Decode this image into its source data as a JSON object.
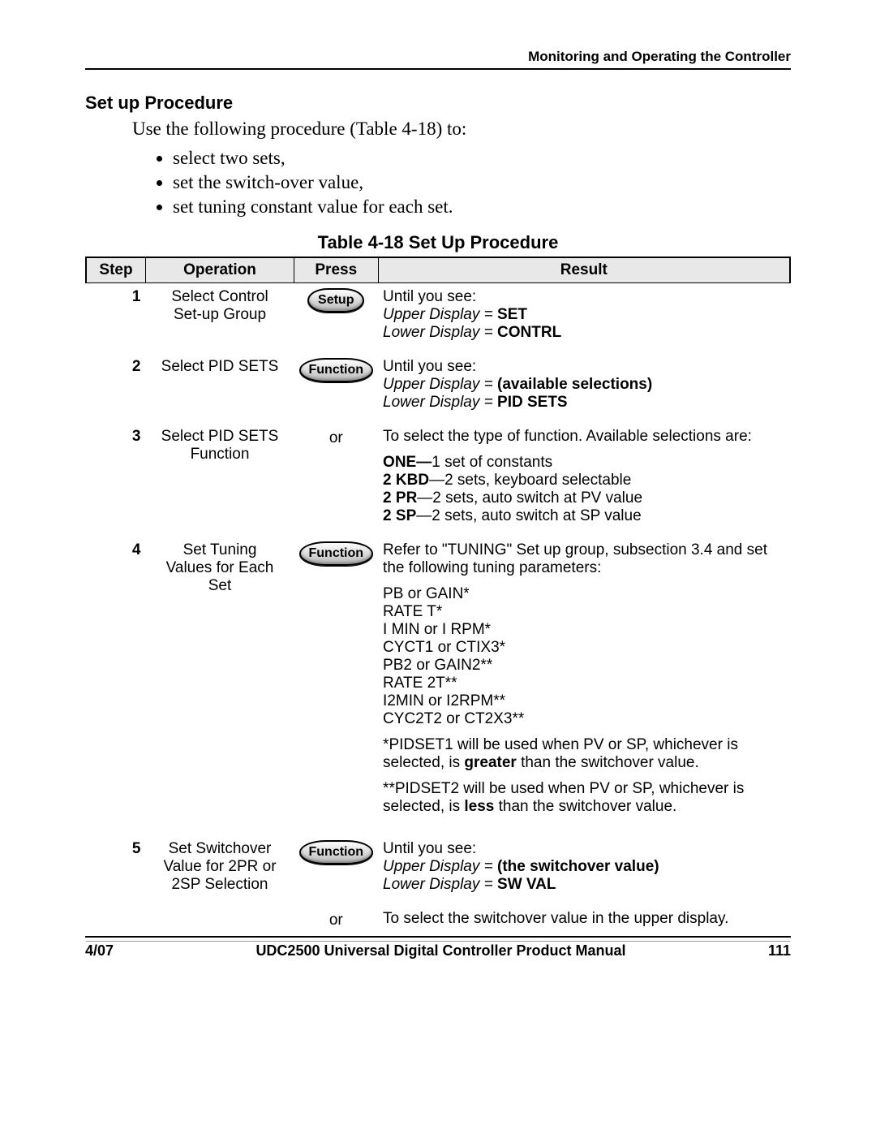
{
  "header": {
    "right": "Monitoring and Operating the Controller"
  },
  "section_title": "Set up Procedure",
  "intro": "Use the following procedure (Table 4-18) to:",
  "bullets": [
    "select two sets,",
    "set the switch-over value,",
    "set tuning constant value for each set."
  ],
  "table_caption": "Table 4-18  Set Up Procedure",
  "thead": {
    "step": "Step",
    "operation": "Operation",
    "press": "Press",
    "result": "Result"
  },
  "keys": {
    "setup": "Setup",
    "function": "Function",
    "or": "or"
  },
  "rows": {
    "r1": {
      "step": "1",
      "op1": "Select Control",
      "op2": "Set-up Group",
      "res_until": "Until you see:",
      "res_upper_lbl": "Upper Display = ",
      "res_upper_val": "SET",
      "res_lower_lbl": "Lower Display = ",
      "res_lower_val": "CONTRL"
    },
    "r2": {
      "step": "2",
      "op1": "Select PID SETS",
      "res_until": "Until you see:",
      "res_upper_lbl": "Upper Display = ",
      "res_upper_val": "(available selections)",
      "res_lower_lbl": "Lower Display = ",
      "res_lower_val": "PID SETS"
    },
    "r3": {
      "step": "3",
      "op1": "Select PID SETS",
      "op2": "Function",
      "res_intro": "To select the type of function. Available selections are:",
      "one_b": "ONE—",
      "one_t": "1 set of constants",
      "kbd_b": "2 KBD",
      "kbd_t": "—2 sets, keyboard selectable",
      "pr_b": "2 PR",
      "pr_t": "—2 sets, auto switch at PV value",
      "sp_b": "2 SP",
      "sp_t": "—2 sets, auto switch at SP value"
    },
    "r4": {
      "step": "4",
      "op1": "Set Tuning",
      "op2": "Values for Each",
      "op3": "Set",
      "res_intro": "Refer to \"TUNING\" Set up group, subsection 3.4 and set the following tuning parameters:",
      "p1": "PB or GAIN*",
      "p2": "RATE T*",
      "p3": "I MIN or I RPM*",
      "p4": "CYCT1 or CTIX3*",
      "p5": "PB2 or GAIN2**",
      "p6": "RATE 2T**",
      "p7": "I2MIN or I2RPM**",
      "p8": "CYC2T2 or CT2X3**",
      "note1a": "*PIDSET1 will be used when PV or SP, whichever is selected, is ",
      "note1b": "greater",
      "note1c": " than the switchover value.",
      "note2a": "**PIDSET2 will be used when PV or SP, whichever is selected, is ",
      "note2b": "less",
      "note2c": " than the switchover value."
    },
    "r5": {
      "step": "5",
      "op1": "Set Switchover",
      "op2": "Value for 2PR or",
      "op3": "2SP Selection",
      "res_until": "Until you see:",
      "res_upper_lbl": "Upper Display = ",
      "res_upper_val": "(the switchover value)",
      "res_lower_lbl": "Lower Display = ",
      "res_lower_val": "SW VAL",
      "res_or": "To select the switchover value in the upper display."
    }
  },
  "footer": {
    "left": "4/07",
    "center": "UDC2500 Universal Digital Controller Product Manual",
    "right": "111"
  }
}
